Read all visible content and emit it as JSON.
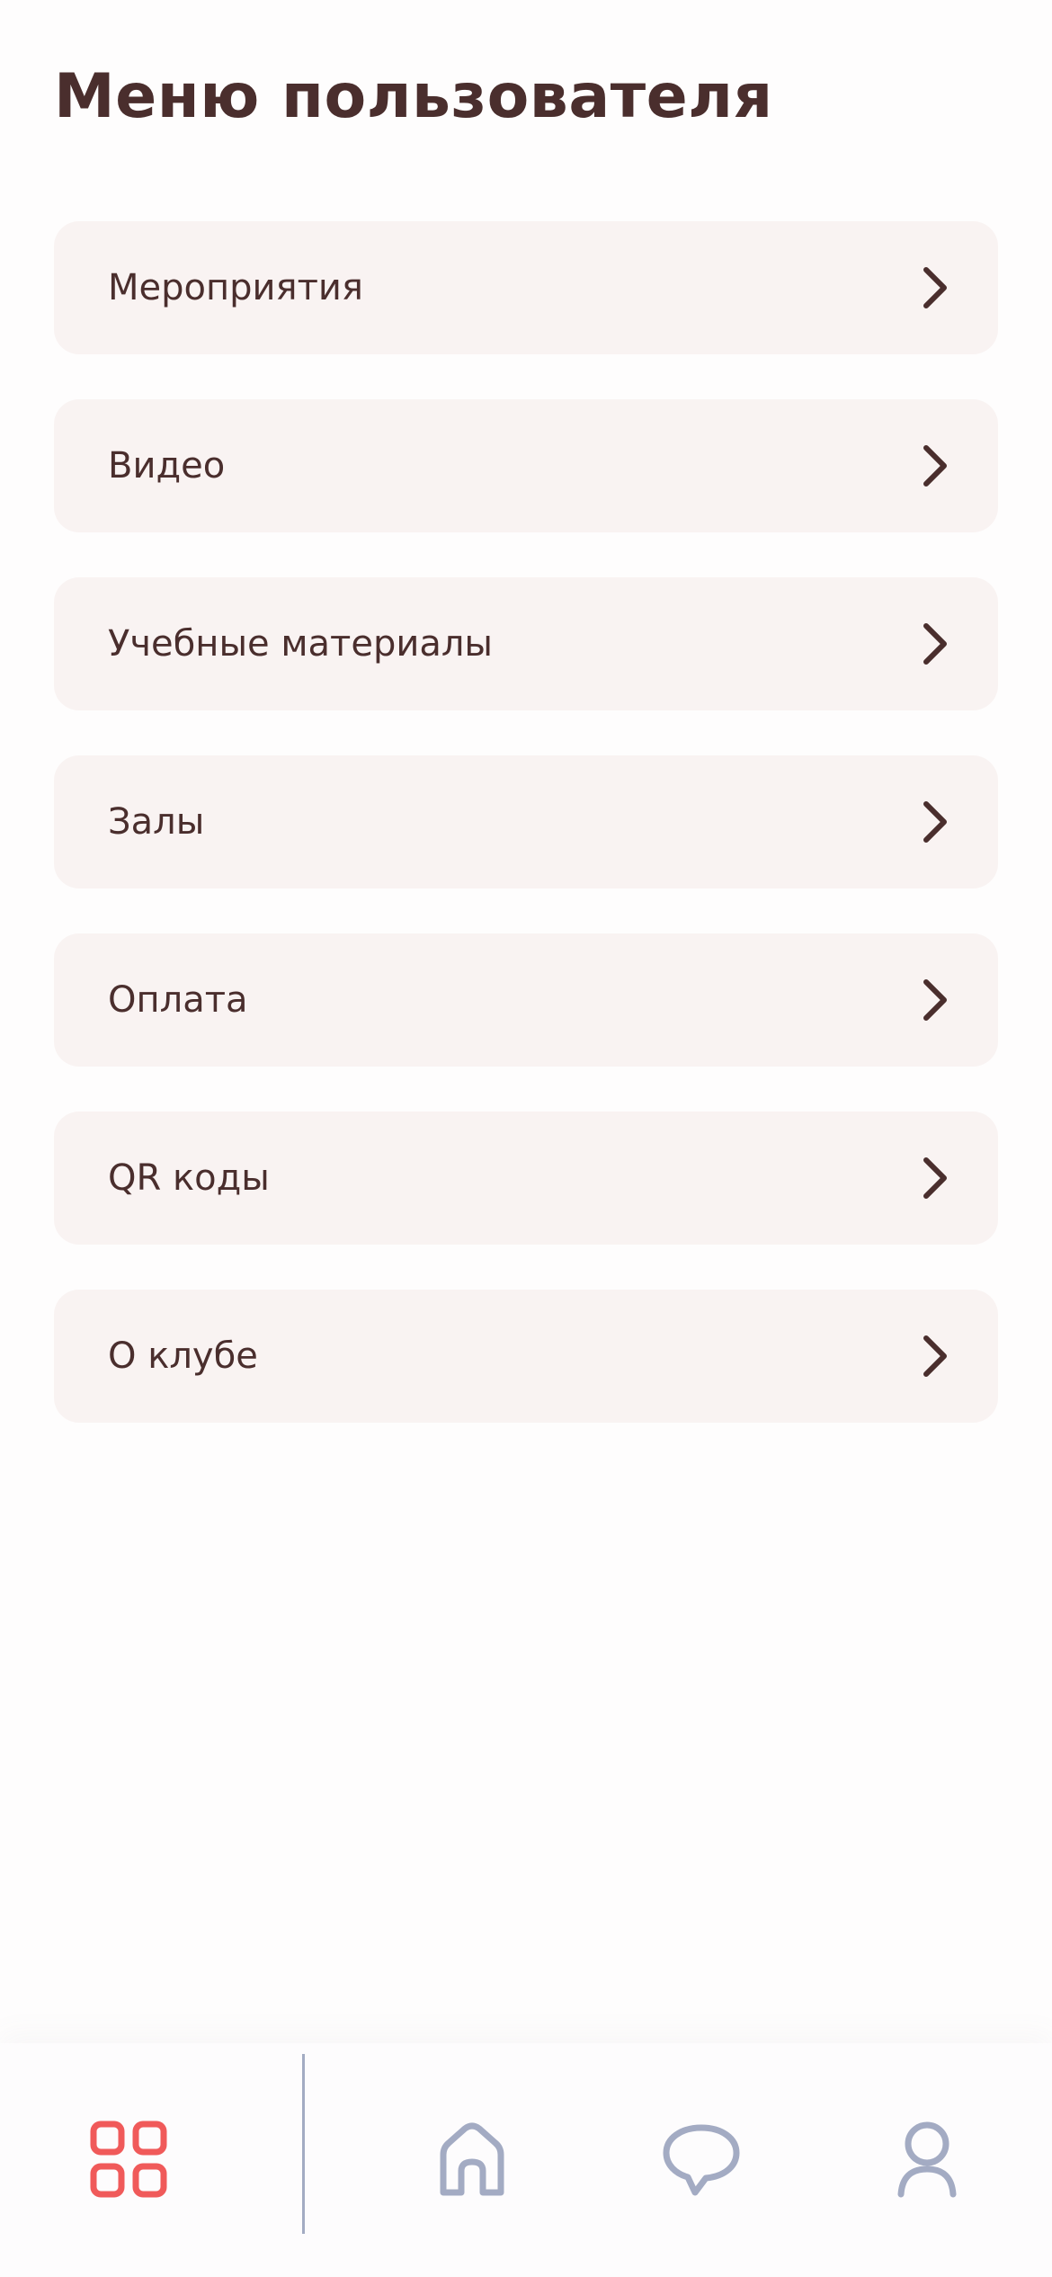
{
  "page": {
    "title": "Меню пользователя"
  },
  "menu": {
    "items": [
      {
        "label": "Мероприятия"
      },
      {
        "label": "Видео"
      },
      {
        "label": "Учебные материалы"
      },
      {
        "label": "Залы"
      },
      {
        "label": "Оплата"
      },
      {
        "label": "QR коды"
      },
      {
        "label": "О клубе"
      }
    ],
    "chevron_icon": "chevron-right-icon"
  },
  "tabbar": {
    "tabs": [
      {
        "icon": "grid-icon",
        "active": true
      },
      {
        "icon": "home-icon",
        "active": false
      },
      {
        "icon": "chat-bubble-icon",
        "active": false
      },
      {
        "icon": "profile-icon",
        "active": false
      }
    ]
  },
  "colors": {
    "text": "#4a2e2d",
    "card_background": "#f9f3f2",
    "accent_active": "#f05a5a",
    "icon_inactive": "#a3abc3"
  }
}
